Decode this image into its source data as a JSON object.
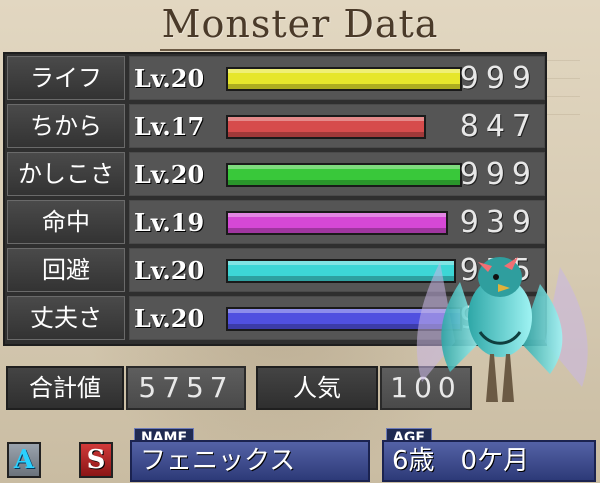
{
  "title": "Monster Data",
  "colors": {
    "life": "#e6e62b",
    "power": "#d64c4c",
    "intelligence": "#39c83a",
    "accuracy": "#d648d6",
    "evasion": "#3dd6d6",
    "defense": "#5050e0"
  },
  "stats": [
    {
      "label": "ライフ",
      "level": "Lv.20",
      "value": "999",
      "fill": 0.999
    },
    {
      "label": "ちから",
      "level": "Lv.17",
      "value": "847",
      "fill": 0.847
    },
    {
      "label": "かしこさ",
      "level": "Lv.20",
      "value": "999",
      "fill": 0.999
    },
    {
      "label": "命中",
      "level": "Lv.19",
      "value": "939",
      "fill": 0.939
    },
    {
      "label": "回避",
      "level": "Lv.20",
      "value": "975",
      "fill": 0.975
    },
    {
      "label": "丈夫さ",
      "level": "Lv.20",
      "value": "998",
      "fill": 0.998
    }
  ],
  "summary": {
    "total_label": "合計値",
    "total_value": "5757",
    "popularity_label": "人気",
    "popularity_value": "100"
  },
  "footer": {
    "icon_a": "A",
    "icon_s": "S",
    "name_tag": "NAME",
    "name_value": "フェニックス",
    "age_tag": "AGE",
    "age_value": "6歳　0ケ月"
  },
  "icons": {
    "monster": "phoenix-monster-icon",
    "rank_a": "rank-a-icon",
    "rank_s": "rank-s-icon"
  }
}
